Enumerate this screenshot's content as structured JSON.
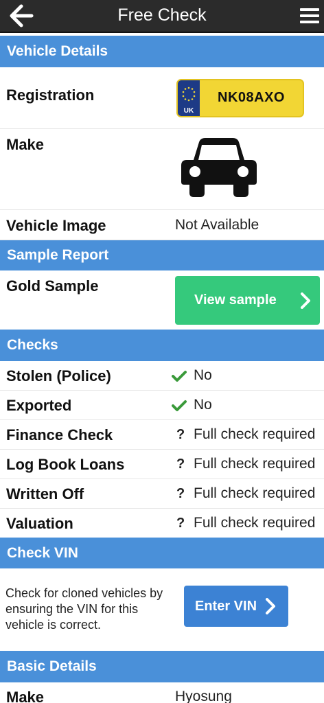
{
  "header": {
    "title": "Free Check"
  },
  "sections": {
    "vehicle_details": "Vehicle Details",
    "sample_report": "Sample Report",
    "checks": "Checks",
    "check_vin": "Check VIN",
    "basic_details": "Basic Details"
  },
  "vehicle": {
    "registration_label": "Registration",
    "plate_country": "UK",
    "plate_number": "NK08AXO",
    "make_label": "Make",
    "make_icon": "car-icon",
    "image_label": "Vehicle Image",
    "image_value": "Not Available"
  },
  "sample": {
    "label": "Gold Sample",
    "button_label": "View sample"
  },
  "checks": [
    {
      "label": "Stolen (Police)",
      "status": "ok",
      "value": "No"
    },
    {
      "label": "Exported",
      "status": "ok",
      "value": "No"
    },
    {
      "label": "Finance Check",
      "status": "unknown",
      "value": "Full check required"
    },
    {
      "label": "Log Book Loans",
      "status": "unknown",
      "value": "Full check required"
    },
    {
      "label": "Written Off",
      "status": "unknown",
      "value": "Full check required"
    },
    {
      "label": "Valuation",
      "status": "unknown",
      "value": "Full check required"
    }
  ],
  "vin": {
    "description": "Check for cloned vehicles by ensuring the VIN for this vehicle is correct.",
    "button_label": "Enter VIN"
  },
  "basic": {
    "make_label": "Make",
    "make_value": "Hyosung"
  },
  "colors": {
    "header_bg": "#2b2b2b",
    "section_bg": "#4a90d9",
    "green_button": "#35c97c",
    "blue_button": "#3c82d4",
    "check_green": "#3a9a3a",
    "plate_yellow": "#f2d634",
    "plate_blue": "#1d3a86"
  }
}
